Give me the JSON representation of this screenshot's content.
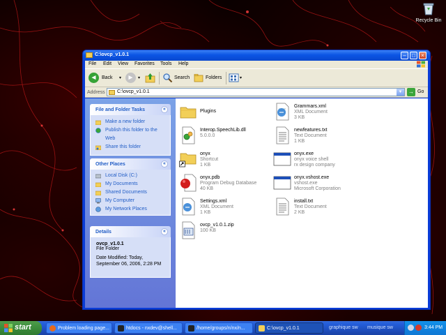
{
  "desktop": {
    "recycle_bin_label": "Recycle Bin"
  },
  "window": {
    "title": "C:\\ovcp_v1.0.1",
    "menu": [
      "File",
      "Edit",
      "View",
      "Favorites",
      "Tools",
      "Help"
    ],
    "toolbar": {
      "back": "Back",
      "search": "Search",
      "folders": "Folders"
    },
    "address": {
      "label": "Address",
      "value": "C:\\ovcp_v1.0.1",
      "go": "Go"
    }
  },
  "sidebar": {
    "tasks": {
      "title": "File and Folder Tasks",
      "items": [
        "Make a new folder",
        "Publish this folder to the",
        "Web",
        "Share this folder"
      ]
    },
    "places": {
      "title": "Other Places",
      "items": [
        "Local Disk (C:)",
        "My Documents",
        "Shared Documents",
        "My Computer",
        "My Network Places"
      ]
    },
    "details": {
      "title": "Details",
      "name": "ovcp_v1.0.1",
      "type": "File Folder",
      "modified_1": "Date Modified: Today,",
      "modified_2": "September 06, 2006, 2:28 PM"
    }
  },
  "files": [
    {
      "name": "Plugins",
      "line2": "",
      "line3": "",
      "icon": "folder-icon"
    },
    {
      "name": "Grammars.xml",
      "line2": "XML Document",
      "line3": "3 KB",
      "icon": "xml-file-icon"
    },
    {
      "name": "Interop.SpeechLib.dll",
      "line2": "5.0.0.0",
      "line3": "",
      "icon": "dll-file-icon"
    },
    {
      "name": "newfeatures.txt",
      "line2": "Text Document",
      "line3": "1 KB",
      "icon": "text-file-icon"
    },
    {
      "name": "onyx",
      "line2": "Shortcut",
      "line3": "1 KB",
      "icon": "shortcut-folder-icon"
    },
    {
      "name": "onyx.exe",
      "line2": "onyx voice shell",
      "line3": "rx design company",
      "icon": "exe-file-icon"
    },
    {
      "name": "onyx.pdb",
      "line2": "Program Debug Database",
      "line3": "40 KB",
      "icon": "pdb-file-icon"
    },
    {
      "name": "onyx.vshost.exe",
      "line2": "vshost.exe",
      "line3": "Microsoft Corporation",
      "icon": "exe-file-icon"
    },
    {
      "name": "Settings.xml",
      "line2": "XML Document",
      "line3": "1 KB",
      "icon": "xml-file-icon"
    },
    {
      "name": "install.txt",
      "line2": "Text Document",
      "line3": "2 KB",
      "icon": "text-file-icon"
    },
    {
      "name": "ovcp_v1.0.1.zip",
      "line2": "100 KB",
      "line3": "",
      "icon": "zip-file-icon"
    }
  ],
  "taskbar": {
    "start": "start",
    "tasks": [
      "Problem loading page...",
      "htdocs - nxdev@shell...",
      "/home/groups/n/nx/n...",
      "C:\\ovcp_v1.0.1"
    ],
    "extra": [
      "graphique sw",
      "musique sw"
    ],
    "clock": "3:44 PM"
  }
}
